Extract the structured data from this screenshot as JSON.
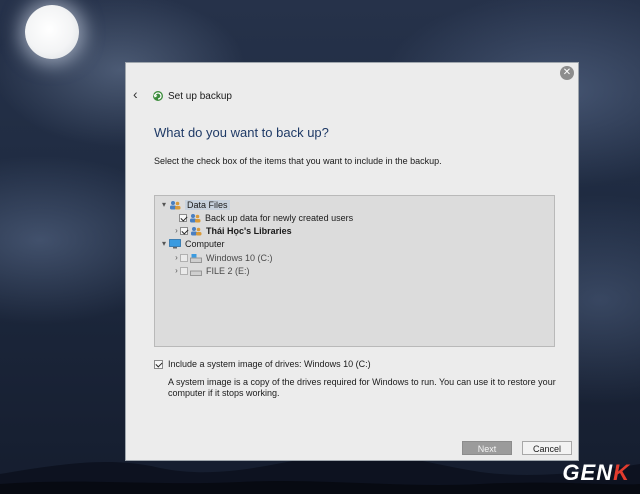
{
  "window": {
    "title": "Set up backup",
    "close_glyph": "✕",
    "back_glyph": "‹"
  },
  "content": {
    "heading": "What do you want to back up?",
    "instruction": "Select the check box of the items that you want to include in the backup."
  },
  "tree": {
    "items": [
      {
        "label": "Data Files",
        "icon": "users-icon",
        "expander": "v",
        "checked": null
      },
      {
        "label": "Back up data for newly created users",
        "icon": "users-icon",
        "expander": "",
        "checked": true
      },
      {
        "label": "Thái Học's Libraries",
        "icon": "users-icon",
        "expander": ">",
        "checked": true
      },
      {
        "label": "Computer",
        "icon": "computer-icon",
        "expander": "v",
        "checked": null
      },
      {
        "label": "Windows 10 (C:)",
        "icon": "drive-icon",
        "expander": ">",
        "checked": false
      },
      {
        "label": "FILE 2 (E:)",
        "icon": "drive-icon",
        "expander": ">",
        "checked": false
      }
    ]
  },
  "system_image": {
    "checked": true,
    "label": "Include a system image of drives: Windows 10 (C:)",
    "description": "A system image is a copy of the drives required for Windows to run. You can use it to restore your computer if it stops working."
  },
  "buttons": {
    "next": "Next",
    "cancel": "Cancel"
  },
  "watermark": {
    "text_main": "GEN",
    "text_accent": "K"
  },
  "colors": {
    "heading": "#1f3a66",
    "tree_background": "#dcdcdc",
    "dialog_background": "#ececec",
    "next_button": "#9b9b9b"
  }
}
